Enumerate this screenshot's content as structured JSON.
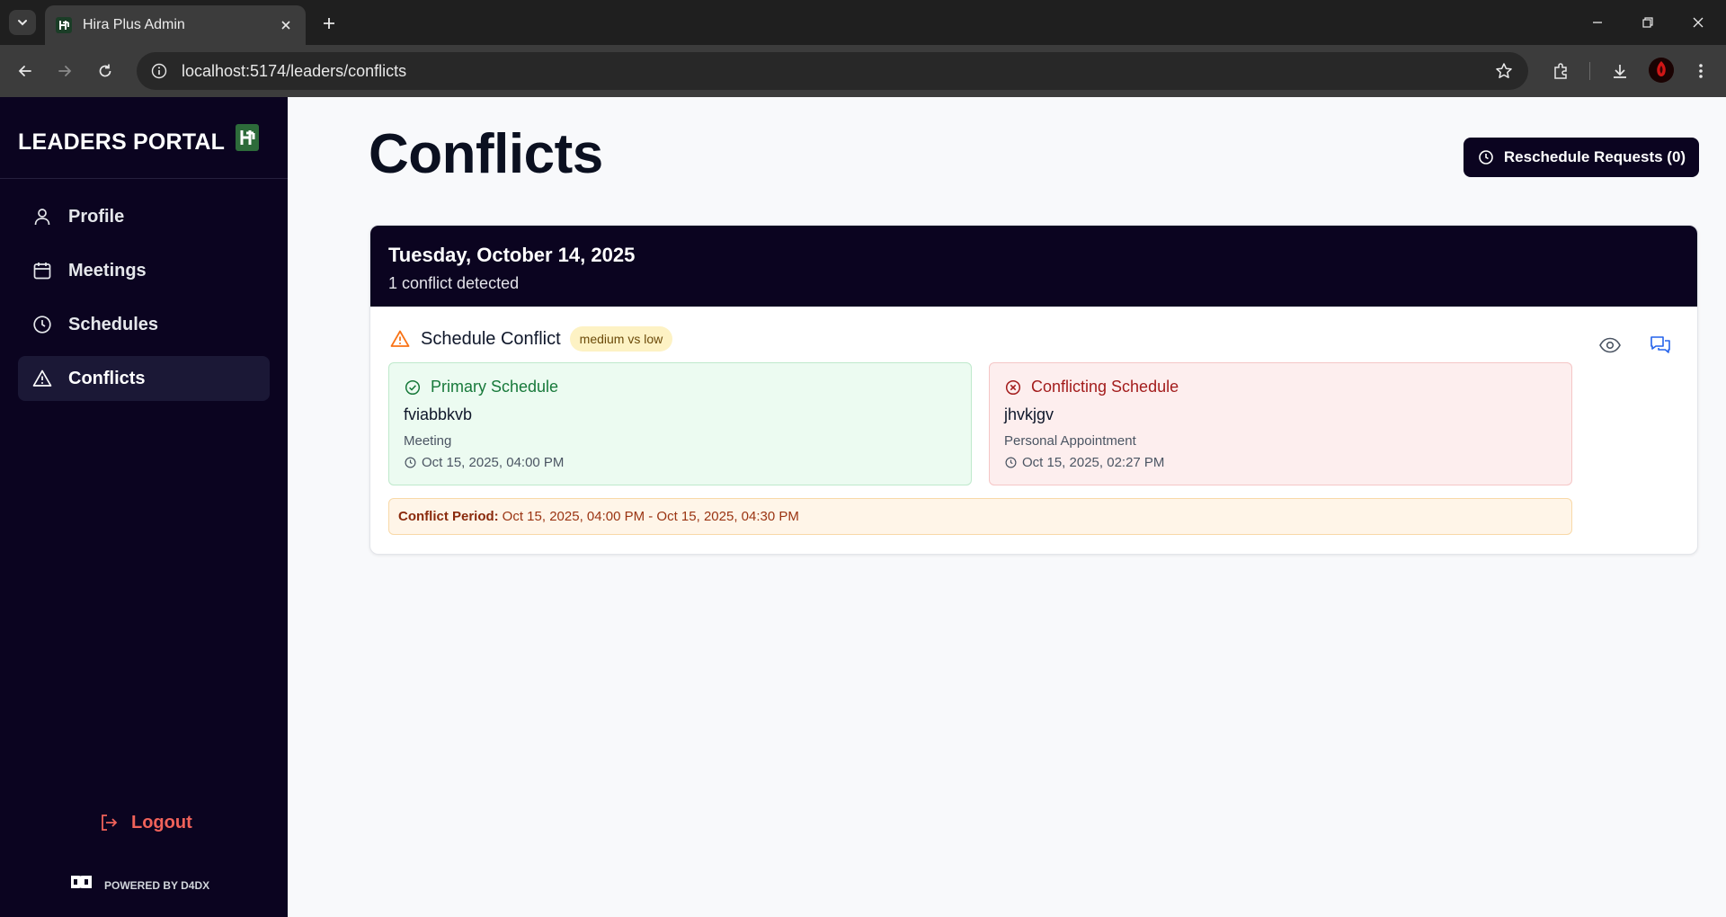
{
  "browser": {
    "tab_title": "Hira Plus Admin",
    "url": "localhost:5174/leaders/conflicts"
  },
  "sidebar": {
    "brand": "LEADERS PORTAL",
    "items": [
      {
        "label": "Profile",
        "icon": "user-icon"
      },
      {
        "label": "Meetings",
        "icon": "calendar-icon"
      },
      {
        "label": "Schedules",
        "icon": "clock-icon"
      },
      {
        "label": "Conflicts",
        "icon": "warning-icon",
        "active": true
      }
    ],
    "logout_label": "Logout",
    "powered_by": "POWERED BY D4DX"
  },
  "main": {
    "title": "Conflicts",
    "reschedule_button": "Reschedule Requests (0)"
  },
  "conflict_group": {
    "date": "Tuesday, October 14, 2025",
    "count_text": "1 conflict detected",
    "conflict": {
      "title": "Schedule Conflict",
      "severity_badge": "medium vs low",
      "primary": {
        "heading": "Primary Schedule",
        "name": "fviabbkvb",
        "type": "Meeting",
        "time": "Oct 15, 2025, 04:00 PM"
      },
      "conflicting": {
        "heading": "Conflicting Schedule",
        "name": "jhvkjgv",
        "type": "Personal Appointment",
        "time": "Oct 15, 2025, 02:27 PM"
      },
      "period_label": "Conflict Period:",
      "period_value": "Oct 15, 2025, 04:00 PM - Oct 15, 2025, 04:30 PM"
    }
  },
  "colors": {
    "sidebar_bg": "#0b0420",
    "logout": "#f0625a",
    "primary_green": "#17793a",
    "conflict_red": "#a31c1c",
    "warning_orange": "#f97316",
    "action_blue": "#2563eb"
  }
}
